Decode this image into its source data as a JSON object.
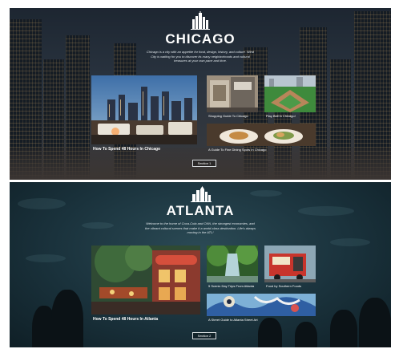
{
  "chicago": {
    "title": "CHICAGO",
    "description": "Chicago is a city with an appetite for food, design, history, and culture. Wind City is waiting for you to discover its many neighborhoods and cultural treasures at your own pace and time.",
    "feature_caption": "How To Spend 48 Hours In Chicago",
    "cards": [
      {
        "caption": "Shopping Guide To Chicago"
      },
      {
        "caption": "Play Ball in Chicago!"
      },
      {
        "caption": "A Guide To Fine Dining Spots In Chicago"
      }
    ],
    "section_button": "Section 1"
  },
  "atlanta": {
    "title": "ATLANTA",
    "description": "Welcome to the home of Coca-Cola and CNN, the strongest economies, and the vibrant cultural scenes that make it a world-class destination. Life's always moving in the ATL!",
    "feature_caption": "How To Spend 48 Hours In Atlanta",
    "cards": [
      {
        "caption": "5 Scenic Day Trips From Atlanta"
      },
      {
        "caption": "Food by Southern Foods"
      },
      {
        "caption": "A Street Guide to Atlanta Street Art"
      }
    ],
    "section_button": "Section 2"
  }
}
